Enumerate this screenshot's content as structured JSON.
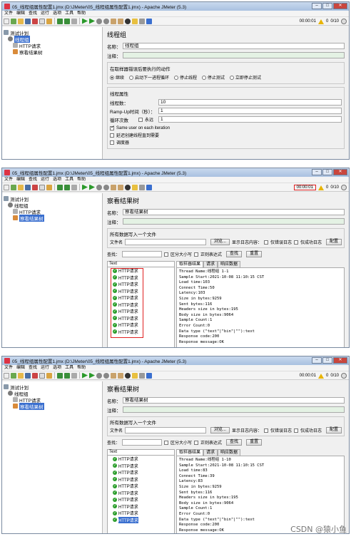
{
  "menu": [
    "文件",
    "编辑",
    "查找",
    "运行",
    "选项",
    "工具",
    "帮助"
  ],
  "shot1": {
    "title": "05_线程组属性配置1.jmx (D:\\JMeter\\05_线程组属性配置1.jmx) - Apache JMeter (5.3)",
    "status": {
      "time": "00:00:01",
      "warn_count": "0",
      "threads": "0/10"
    },
    "tree": [
      "测试计划",
      "线程组",
      "HTTP请求",
      "察看结果树"
    ],
    "panel": {
      "heading": "线程组",
      "name_label": "名称：",
      "name_value": "线程组",
      "comment_label": "注释：",
      "error_group_title": "在取样器错误后要执行的动作",
      "radios": [
        "继续",
        "启动下一进程循环",
        "停止线程",
        "停止测试",
        "立即停止测试"
      ],
      "props_title": "线程属性",
      "threads_label": "线程数：",
      "threads_value": "10",
      "rampup_label": "Ramp-Up时间（秒）：",
      "rampup_value": "1",
      "loop_label": "循环次数",
      "forever_label": "永远",
      "loop_value": "1",
      "same_user": "Same user on each iteration",
      "delay_create": "延迟创建线程直到需要",
      "scheduler": "调度器"
    }
  },
  "shot2": {
    "title": "05_线程组属性配置1.jmx (D:\\JMeter\\05_线程组属性配置1.jmx) - Apache JMeter (5.3)",
    "status": {
      "time": "00:00:01",
      "warn_count": "0",
      "threads": "0/10"
    },
    "tree": [
      "测试计划",
      "线程组",
      "HTTP请求",
      "察看结果树"
    ],
    "panel": {
      "heading": "察看结果树",
      "name_label": "名称：",
      "name_value": "察看结果树",
      "comment_label": "注释：",
      "file_group": "所有数据写入一个文件",
      "file_label": "文件名",
      "browse": "浏览...",
      "log_show": "显示日志内容：",
      "only_err": "仅错误日志",
      "only_ok": "仅成功日志",
      "config": "配置",
      "search_label": "查找：",
      "case_label": "区分大小写",
      "regex_label": "正则表达式",
      "find_btn": "查找",
      "reset_btn": "重置",
      "combo": "Text",
      "items": [
        "HTTP请求",
        "HTTP请求",
        "HTTP请求",
        "HTTP请求",
        "HTTP请求",
        "HTTP请求",
        "HTTP请求",
        "HTTP请求",
        "HTTP请求",
        "HTTP请求"
      ],
      "tabs": [
        "取样器结果",
        "请求",
        "响应数据"
      ],
      "detail": "Thread Name:线程组 1-1\nSample Start:2021-10-08 11:10:15 CST\nLoad time:103\nConnect Time:50\nLatency:103\nSize in bytes:9259\nSent bytes:116\nHeaders size in bytes:195\nBody size in bytes:9064\nSample Count:1\nError Count:0\nData type (\"text\"|\"bin\"|\"\"):text\nResponse code:200\nResponse message:OK"
    }
  },
  "shot3": {
    "title": "05_线程组属性配置1.jmx (D:\\JMeter\\05_线程组属性配置1.jmx) - Apache JMeter (5.3)",
    "status": {
      "time": "00:00:01",
      "warn_count": "0",
      "threads": "0/10"
    },
    "tree": [
      "测试计划",
      "线程组",
      "HTTP请求",
      "察看结果树"
    ],
    "panel": {
      "heading": "察看结果树",
      "name_label": "名称：",
      "name_value": "察看结果树",
      "comment_label": "注释：",
      "file_group": "所有数据写入一个文件",
      "file_label": "文件名",
      "browse": "浏览...",
      "log_show": "显示日志内容：",
      "only_err": "仅错误日志",
      "only_ok": "仅成功日志",
      "config": "配置",
      "search_label": "查找：",
      "case_label": "区分大小写",
      "regex_label": "正则表达式",
      "find_btn": "查找",
      "reset_btn": "重置",
      "combo": "Text",
      "items": [
        "HTTP请求",
        "HTTP请求",
        "HTTP请求",
        "HTTP请求",
        "HTTP请求",
        "HTTP请求",
        "HTTP请求",
        "HTTP请求",
        "HTTP请求",
        "HTTP请求"
      ],
      "tabs": [
        "取样器结果",
        "请求",
        "响应数据"
      ],
      "detail": "Thread Name:线程组 1-10\nSample Start:2021-10-08 11:10:15 CST\nLoad time:83\nConnect Time:39\nLatency:83\nSize in bytes:9259\nSent bytes:116\nHeaders size in bytes:195\nBody size in bytes:9064\nSample Count:1\nError Count:0\nData type (\"text\"|\"bin\"|\"\"):text\nResponse code:200\nResponse message:OK"
    }
  },
  "watermark": "CSDN @猿小鱼"
}
